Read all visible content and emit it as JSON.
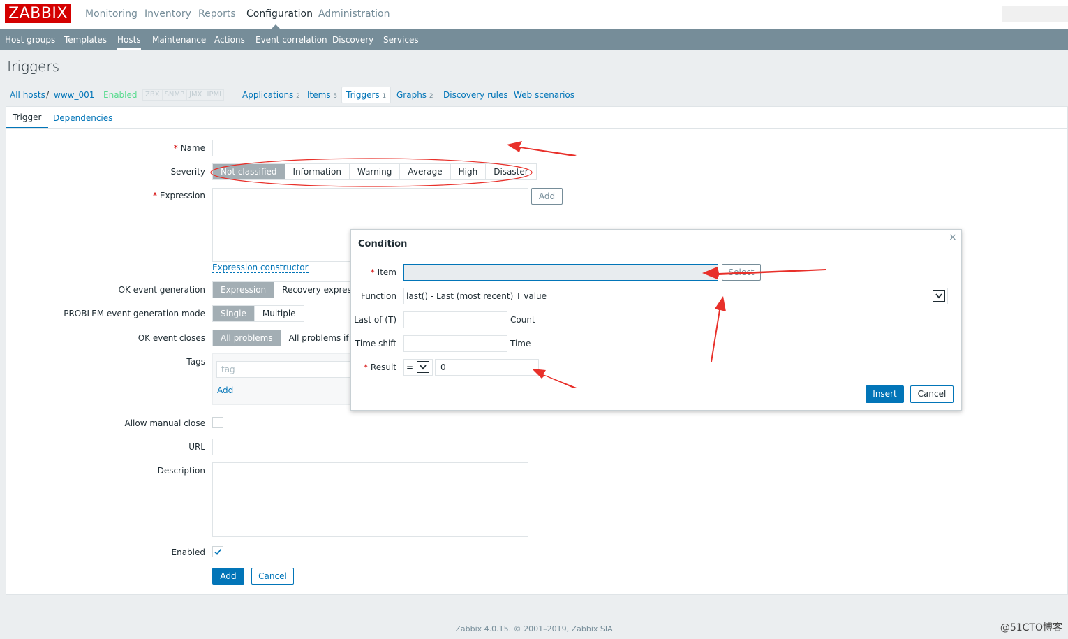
{
  "header": {
    "logo": "ZABBIX",
    "main_menu": [
      "Monitoring",
      "Inventory",
      "Reports",
      "Configuration",
      "Administration"
    ],
    "sub_menu": [
      "Host groups",
      "Templates",
      "Hosts",
      "Maintenance",
      "Actions",
      "Event correlation",
      "Discovery",
      "Services"
    ]
  },
  "page": {
    "title": "Triggers"
  },
  "breadcrumb": {
    "all_hosts": "All hosts",
    "separator": "/",
    "host": "www_001",
    "status": "Enabled",
    "protocols": [
      "ZBX",
      "SNMP",
      "JMX",
      "IPMI"
    ],
    "applications": "Applications",
    "applications_count": "2",
    "items": "Items",
    "items_count": "5",
    "triggers": "Triggers",
    "triggers_count": "1",
    "graphs": "Graphs",
    "graphs_count": "2",
    "discovery_rules": "Discovery rules",
    "web_scenarios": "Web scenarios"
  },
  "tabs": {
    "trigger": "Trigger",
    "dependencies": "Dependencies"
  },
  "form": {
    "required_mark": "*",
    "name_label": "Name",
    "name_value": "",
    "severity_label": "Severity",
    "severity_options": [
      "Not classified",
      "Information",
      "Warning",
      "Average",
      "High",
      "Disaster"
    ],
    "severity_selected": "Not classified",
    "expression_label": "Expression",
    "expression_add": "Add",
    "expression_constructor": "Expression constructor",
    "ok_event_generation_label": "OK event generation",
    "ok_event_generation_options": [
      "Expression",
      "Recovery expression"
    ],
    "problem_mode_label": "PROBLEM event generation mode",
    "problem_mode_options": [
      "Single",
      "Multiple"
    ],
    "ok_event_closes_label": "OK event closes",
    "ok_event_closes_options": [
      "All problems",
      "All problems if tag"
    ],
    "tags_label": "Tags",
    "tags_placeholder": "tag",
    "tags_add": "Add",
    "allow_manual_close_label": "Allow manual close",
    "url_label": "URL",
    "description_label": "Description",
    "enabled_label": "Enabled",
    "enabled_checked": true,
    "add_button": "Add",
    "cancel_button": "Cancel"
  },
  "dialog": {
    "title": "Condition",
    "close": "×",
    "item_label": "Item",
    "item_value": "",
    "select_button": "Select",
    "function_label": "Function",
    "function_value": "last() - Last (most recent) T value",
    "last_of_label": "Last of (T)",
    "last_of_unit": "Count",
    "time_shift_label": "Time shift",
    "time_shift_unit": "Time",
    "result_label": "Result",
    "result_operator": "=",
    "result_value": "0",
    "insert_button": "Insert",
    "cancel_button": "Cancel"
  },
  "footer": {
    "text": "Zabbix 4.0.15. © 2001–2019, Zabbix SIA"
  },
  "watermark": "@51CTO博客",
  "colors": {
    "brand": "#d40000",
    "nav": "#768d99",
    "accent": "#0275b8",
    "annotation": "#e8302a"
  }
}
